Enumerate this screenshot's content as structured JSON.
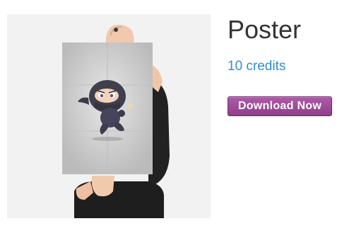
{
  "product": {
    "title": "Poster",
    "price": "10 credits",
    "download_label": "Download Now",
    "image_subject": "ninja-poster",
    "colors": {
      "price": "#2f8fd6",
      "button": "#9b4a96",
      "title": "#333333"
    }
  }
}
